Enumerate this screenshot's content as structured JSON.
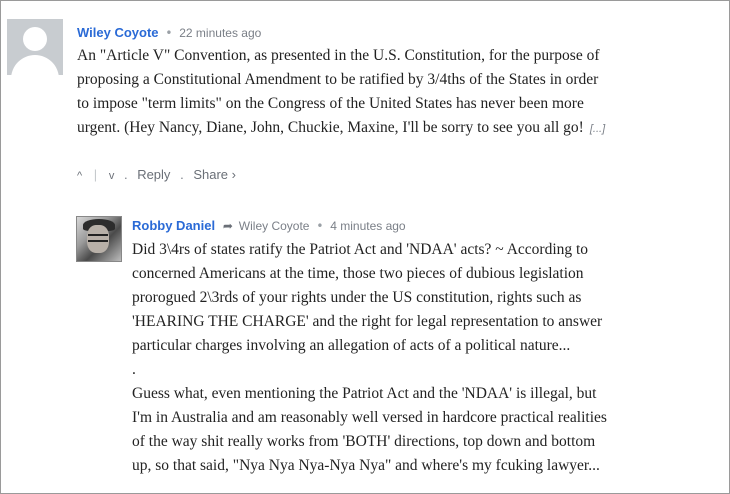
{
  "comments": [
    {
      "author": "Wiley Coyote",
      "separator": "•",
      "time": "22 minutes ago",
      "avatar_icon": "generic-user-avatar",
      "body_lines": [
        "An \"Article V\" Convention, as presented in the U.S. Constitution, for the purpose of",
        "proposing a Constitutional Amendment to be ratified by 3/4ths of the States in order",
        "to impose \"term limits\" on the Congress of the United States has never been more",
        "urgent. (Hey Nancy, Diane, John, Chuckie, Maxine, I'll be sorry to see you all go!"
      ],
      "more_label": "[...]",
      "actions": {
        "upvote_icon": "^",
        "downvote_icon": "v",
        "dot": ".",
        "reply_label": "Reply",
        "share_label": "Share ›"
      }
    },
    {
      "author": "Robby Daniel",
      "reply_arrow": "➦",
      "reply_to": "Wiley Coyote",
      "separator": "•",
      "time": "4 minutes ago",
      "avatar_icon": "user-photo-avatar",
      "body_lines": [
        "Did 3\\4rs of states ratify the Patriot Act and 'NDAA' acts? ~ According to",
        "concerned Americans at the time, those two pieces of dubious legislation",
        "prorogued 2\\3rds of your rights under the US constitution, rights such as",
        "'HEARING THE CHARGE' and the right for legal representation to answer",
        "particular charges involving an allegation of acts of a political nature...",
        ".",
        "Guess what, even mentioning the Patriot Act and the 'NDAA' is illegal, but",
        "I'm in Australia and am reasonably well versed in hardcore practical realities",
        "of the way shit really works from 'BOTH' directions, top down and bottom",
        "up, so that said, \"Nya Nya Nya-Nya Nya\" and where's my fcuking lawyer..."
      ]
    }
  ]
}
